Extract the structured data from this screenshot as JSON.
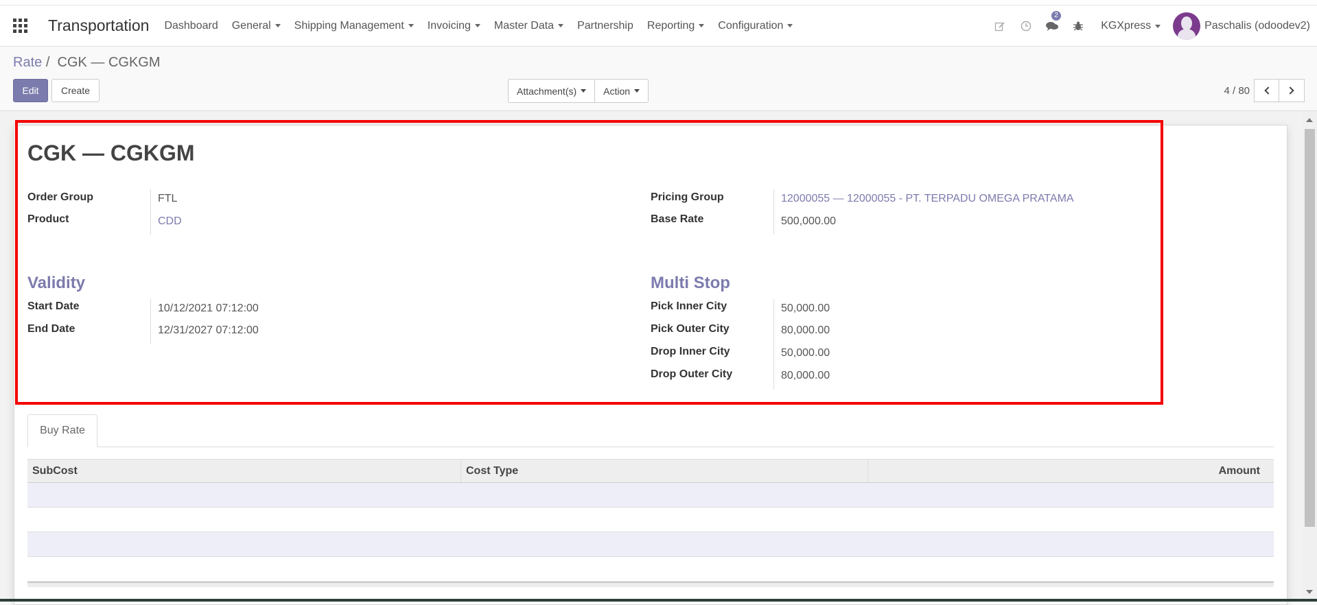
{
  "navbar": {
    "app_title": "Transportation",
    "menu": [
      {
        "label": "Dashboard",
        "dropdown": false
      },
      {
        "label": "General",
        "dropdown": true
      },
      {
        "label": "Shipping Management",
        "dropdown": true
      },
      {
        "label": "Invoicing",
        "dropdown": true
      },
      {
        "label": "Master Data",
        "dropdown": true
      },
      {
        "label": "Partnership",
        "dropdown": false
      },
      {
        "label": "Reporting",
        "dropdown": true
      },
      {
        "label": "Configuration",
        "dropdown": true
      }
    ],
    "icons": [
      "edit-icon",
      "clock-icon",
      "chat-icon",
      "bug-icon"
    ],
    "messages_badge": "2",
    "company": "KGXpress",
    "user": "Paschalis (odoodev2)"
  },
  "breadcrumb": {
    "parent": "Rate",
    "separator": "/",
    "current": "CGK — CGKGM"
  },
  "buttons": {
    "edit": "Edit",
    "create": "Create",
    "attachments": "Attachment(s)",
    "action": "Action"
  },
  "pager": {
    "value": "4 / 80"
  },
  "form": {
    "title": "CGK — CGKGM",
    "left": {
      "order_group_label": "Order Group",
      "order_group_value": "FTL",
      "product_label": "Product",
      "product_value": "CDD"
    },
    "right": {
      "pricing_group_label": "Pricing Group",
      "pricing_group_value": "12000055 — 12000055 - PT. TERPADU OMEGA PRATAMA",
      "base_rate_label": "Base Rate",
      "base_rate_value": "500,000.00"
    },
    "validity": {
      "title": "Validity",
      "start_label": "Start Date",
      "start_value": "10/12/2021 07:12:00",
      "end_label": "End Date",
      "end_value": "12/31/2027 07:12:00"
    },
    "multi_stop": {
      "title": "Multi Stop",
      "pick_inner_label": "Pick Inner City",
      "pick_inner_value": "50,000.00",
      "pick_outer_label": "Pick Outer City",
      "pick_outer_value": "80,000.00",
      "drop_inner_label": "Drop Inner City",
      "drop_inner_value": "50,000.00",
      "drop_outer_label": "Drop Outer City",
      "drop_outer_value": "80,000.00"
    }
  },
  "notebook": {
    "tab": "Buy Rate",
    "columns": [
      "SubCost",
      "Cost Type",
      "Amount"
    ]
  },
  "colors": {
    "accent": "#7c7bad",
    "highlight": "#f50000"
  }
}
